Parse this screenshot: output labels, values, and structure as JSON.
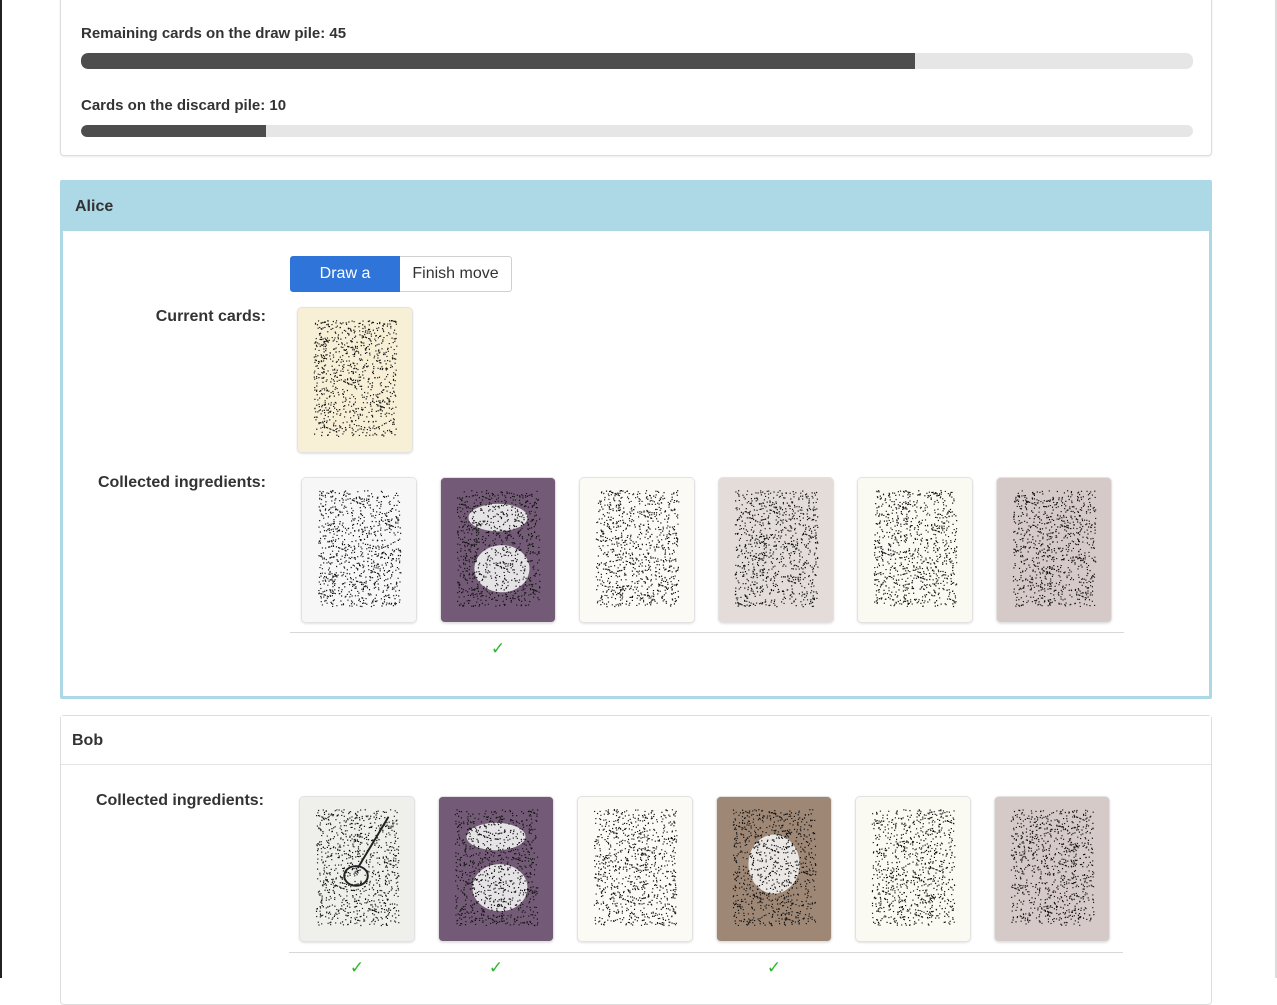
{
  "stats": {
    "draw_pile_label": "Remaining cards on the draw pile: 45",
    "draw_pile_progress": 0.75,
    "discard_pile_label": "Cards on the discard pile: 10",
    "discard_pile_progress": 0.166
  },
  "alice": {
    "name": "Alice",
    "buttons": {
      "draw": "Draw a card",
      "finish": "Finish move"
    },
    "current_cards_label": "Current cards:",
    "collected_label": "Collected ingredients:",
    "current_cards": [
      {
        "icon": "spice-card-icon",
        "color": "#f7f0d6"
      }
    ],
    "ingredients": [
      {
        "icon": "ingredient-card-icon",
        "color": "#f7f7f7",
        "collected": false
      },
      {
        "icon": "bean-card-icon",
        "color": "#735a76",
        "collected": true
      },
      {
        "icon": "ingredient-card-icon",
        "color": "#fbfaf5",
        "collected": false
      },
      {
        "icon": "ingredient-card-icon",
        "color": "#e3dcd8",
        "collected": false
      },
      {
        "icon": "ingredient-card-icon",
        "color": "#fafaf2",
        "collected": false
      },
      {
        "icon": "ingredient-card-icon",
        "color": "#d6cac8",
        "collected": false
      }
    ]
  },
  "bob": {
    "name": "Bob",
    "collected_label": "Collected ingredients:",
    "ingredients": [
      {
        "icon": "spoon-card-icon",
        "color": "#efefeb",
        "collected": true
      },
      {
        "icon": "bean-card-icon",
        "color": "#735a76",
        "collected": true
      },
      {
        "icon": "ingredient-card-icon",
        "color": "#fbfaf5",
        "collected": false
      },
      {
        "icon": "vegetable-card-icon",
        "color": "#9e8775",
        "collected": true
      },
      {
        "icon": "ingredient-card-icon",
        "color": "#fafaf2",
        "collected": false
      },
      {
        "icon": "ingredient-card-icon",
        "color": "#d6cac8",
        "collected": false
      }
    ]
  },
  "check_glyph": "✓"
}
